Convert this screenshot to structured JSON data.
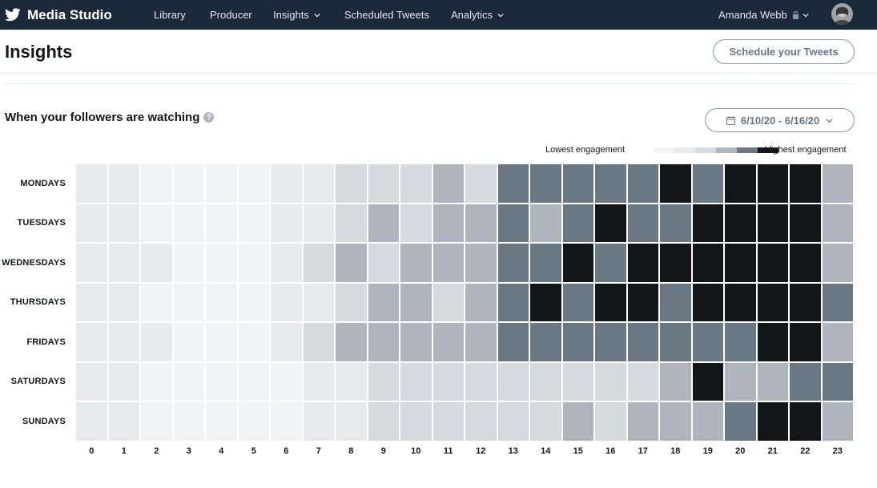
{
  "nav": {
    "brand": "Media Studio",
    "items": [
      {
        "label": "Library",
        "dropdown": false
      },
      {
        "label": "Producer",
        "dropdown": false
      },
      {
        "label": "Insights",
        "dropdown": true
      },
      {
        "label": "Scheduled Tweets",
        "dropdown": false
      },
      {
        "label": "Analytics",
        "dropdown": true
      }
    ],
    "user_name": "Amanda Webb"
  },
  "header": {
    "title": "Insights",
    "schedule_button": "Schedule your Tweets"
  },
  "section": {
    "title": "When your followers are watching",
    "date_range": "6/10/20 - 6/16/20"
  },
  "legend": {
    "low_label": "Lowest engagement",
    "high_label": "Highest engagement",
    "colors": [
      "#ffffff",
      "#f1f3f5",
      "#e8ebed",
      "#d5dadf",
      "#aeb5bc",
      "#6a7884",
      "#14171a"
    ]
  },
  "chart_data": {
    "type": "heatmap",
    "title": "When your followers are watching",
    "rows": [
      "MONDAYS",
      "TUESDAYS",
      "WEDNESDAYS",
      "THURSDAYS",
      "FRIDAYS",
      "SATURDAYS",
      "SUNDAYS"
    ],
    "columns": [
      "0",
      "1",
      "2",
      "3",
      "4",
      "5",
      "6",
      "7",
      "8",
      "9",
      "10",
      "11",
      "12",
      "13",
      "14",
      "15",
      "16",
      "17",
      "18",
      "19",
      "20",
      "21",
      "22",
      "23"
    ],
    "scale": "0 = lowest engagement, 6 = highest engagement",
    "values": [
      [
        2,
        2,
        1,
        1,
        1,
        1,
        2,
        2,
        3,
        3,
        3,
        4,
        3,
        5,
        5,
        5,
        5,
        5,
        6,
        5,
        6,
        6,
        6,
        4
      ],
      [
        2,
        2,
        1,
        1,
        1,
        1,
        2,
        2,
        3,
        4,
        3,
        4,
        4,
        5,
        4,
        5,
        6,
        5,
        5,
        6,
        6,
        6,
        6,
        4
      ],
      [
        2,
        2,
        2,
        1,
        1,
        1,
        2,
        3,
        4,
        3,
        4,
        4,
        4,
        5,
        5,
        6,
        5,
        6,
        6,
        6,
        6,
        6,
        6,
        4
      ],
      [
        2,
        2,
        1,
        1,
        1,
        1,
        2,
        2,
        3,
        4,
        4,
        3,
        4,
        5,
        6,
        5,
        6,
        6,
        5,
        6,
        6,
        6,
        6,
        5
      ],
      [
        2,
        2,
        2,
        1,
        1,
        1,
        2,
        3,
        4,
        4,
        4,
        4,
        4,
        5,
        5,
        5,
        5,
        5,
        5,
        5,
        5,
        6,
        6,
        4
      ],
      [
        2,
        2,
        1,
        1,
        1,
        1,
        1,
        2,
        2,
        3,
        3,
        3,
        3,
        3,
        3,
        3,
        3,
        3,
        4,
        6,
        4,
        4,
        5,
        5
      ],
      [
        2,
        2,
        1,
        1,
        1,
        1,
        1,
        2,
        2,
        3,
        3,
        3,
        3,
        3,
        3,
        4,
        3,
        4,
        4,
        4,
        5,
        6,
        6,
        4
      ]
    ]
  }
}
